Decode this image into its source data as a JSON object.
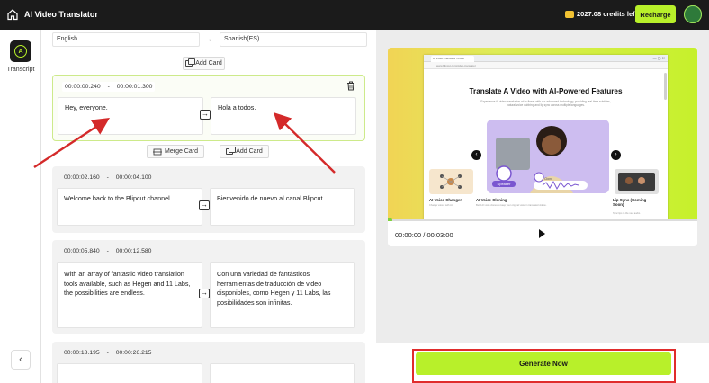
{
  "header": {
    "app_title": "AI Video Translator",
    "credits": "2027.08 credits left",
    "recharge_label": "Recharge"
  },
  "rail": {
    "tool_label": "Transcript"
  },
  "languages": {
    "source": "English",
    "target": "Spanish(ES)",
    "arrow": "→"
  },
  "actions": {
    "add_card": "Add Card",
    "merge_card": "Merge Card"
  },
  "cards": [
    {
      "start": "00:00:00.240",
      "end": "00:00:01.300",
      "source": "Hey, everyone.",
      "target": "Hola a todos."
    },
    {
      "start": "00:00:02.160",
      "end": "00:00:04.100",
      "source": "Welcome back to the Blipcut channel.",
      "target": "Bienvenido de nuevo al canal Blipcut."
    },
    {
      "start": "00:00:05.840",
      "end": "00:00:12.580",
      "source": "With an array of fantastic video translation tools available, such as Hegen and 11 Labs, the possibilities are endless.",
      "target": "Con una variedad de fantásticos herramientas de traducción de video disponibles, como Hegen y 11 Labs, las posibilidades son infinitas."
    },
    {
      "start": "00:00:18.195",
      "end": "00:00:26.215",
      "source": "",
      "target": ""
    }
  ],
  "time_separator": "-",
  "preview": {
    "tab_text": "AI Video Translator Online",
    "url_text": "www.blipcut.com/video-translator",
    "web_title": "Translate A Video with AI-Powered Features",
    "web_subtitle": "Experience AI video translation at its finest with our advanced technology, providing real-time subtitles, natural voice dubbing and lip sync across multiple languages.",
    "badge_left": "Speaker",
    "badge_right": "Clone",
    "caption_left": "AI Voice Changer",
    "caption_center": "AI Voice Cloning",
    "caption_right": "Lip Sync (Coming Soon)",
    "caption_center_sub": "Build AI voice clones to keep your original voice in translated videos.",
    "caption_left_sub": "Change voices with AI.",
    "caption_right_sub": "Sync lips to the new audio.",
    "progress": 0.0
  },
  "player": {
    "time": "00:00:00 / 00:03:00"
  },
  "footer": {
    "generate_label": "Generate Now"
  },
  "colors": {
    "accent": "#b8f02a",
    "annotation_red": "#e02c2c",
    "topbar": "#1b1b1b"
  }
}
